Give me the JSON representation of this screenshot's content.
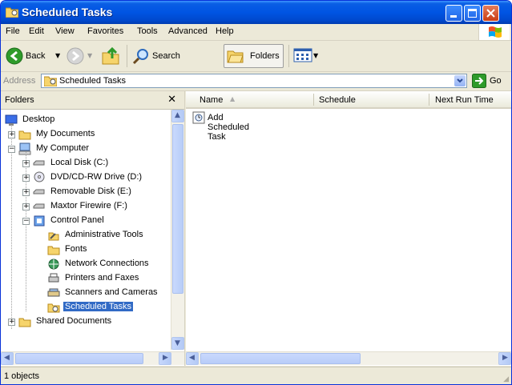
{
  "window": {
    "title": "Scheduled Tasks"
  },
  "menu": [
    "File",
    "Edit",
    "View",
    "Favorites",
    "Tools",
    "Advanced",
    "Help"
  ],
  "toolbar": {
    "back": "Back",
    "search": "Search",
    "folders": "Folders"
  },
  "address": {
    "label": "Address",
    "value": "Scheduled Tasks",
    "go": "Go"
  },
  "folders_pane": {
    "title": "Folders"
  },
  "tree": [
    {
      "label": "Desktop"
    },
    {
      "label": "My Documents"
    },
    {
      "label": "My Computer"
    },
    {
      "label": "Local Disk (C:)"
    },
    {
      "label": "DVD/CD-RW Drive (D:)"
    },
    {
      "label": "Removable Disk (E:)"
    },
    {
      "label": "Maxtor Firewire (F:)"
    },
    {
      "label": "Control Panel"
    },
    {
      "label": "Administrative Tools"
    },
    {
      "label": "Fonts"
    },
    {
      "label": "Network Connections"
    },
    {
      "label": "Printers and Faxes"
    },
    {
      "label": "Scanners and Cameras"
    },
    {
      "label": "Scheduled Tasks"
    },
    {
      "label": "Shared Documents"
    }
  ],
  "columns": [
    "Name",
    "Schedule",
    "Next Run Time"
  ],
  "items": [
    {
      "label": "Add Scheduled Task"
    }
  ],
  "status": {
    "text": "1 objects"
  }
}
